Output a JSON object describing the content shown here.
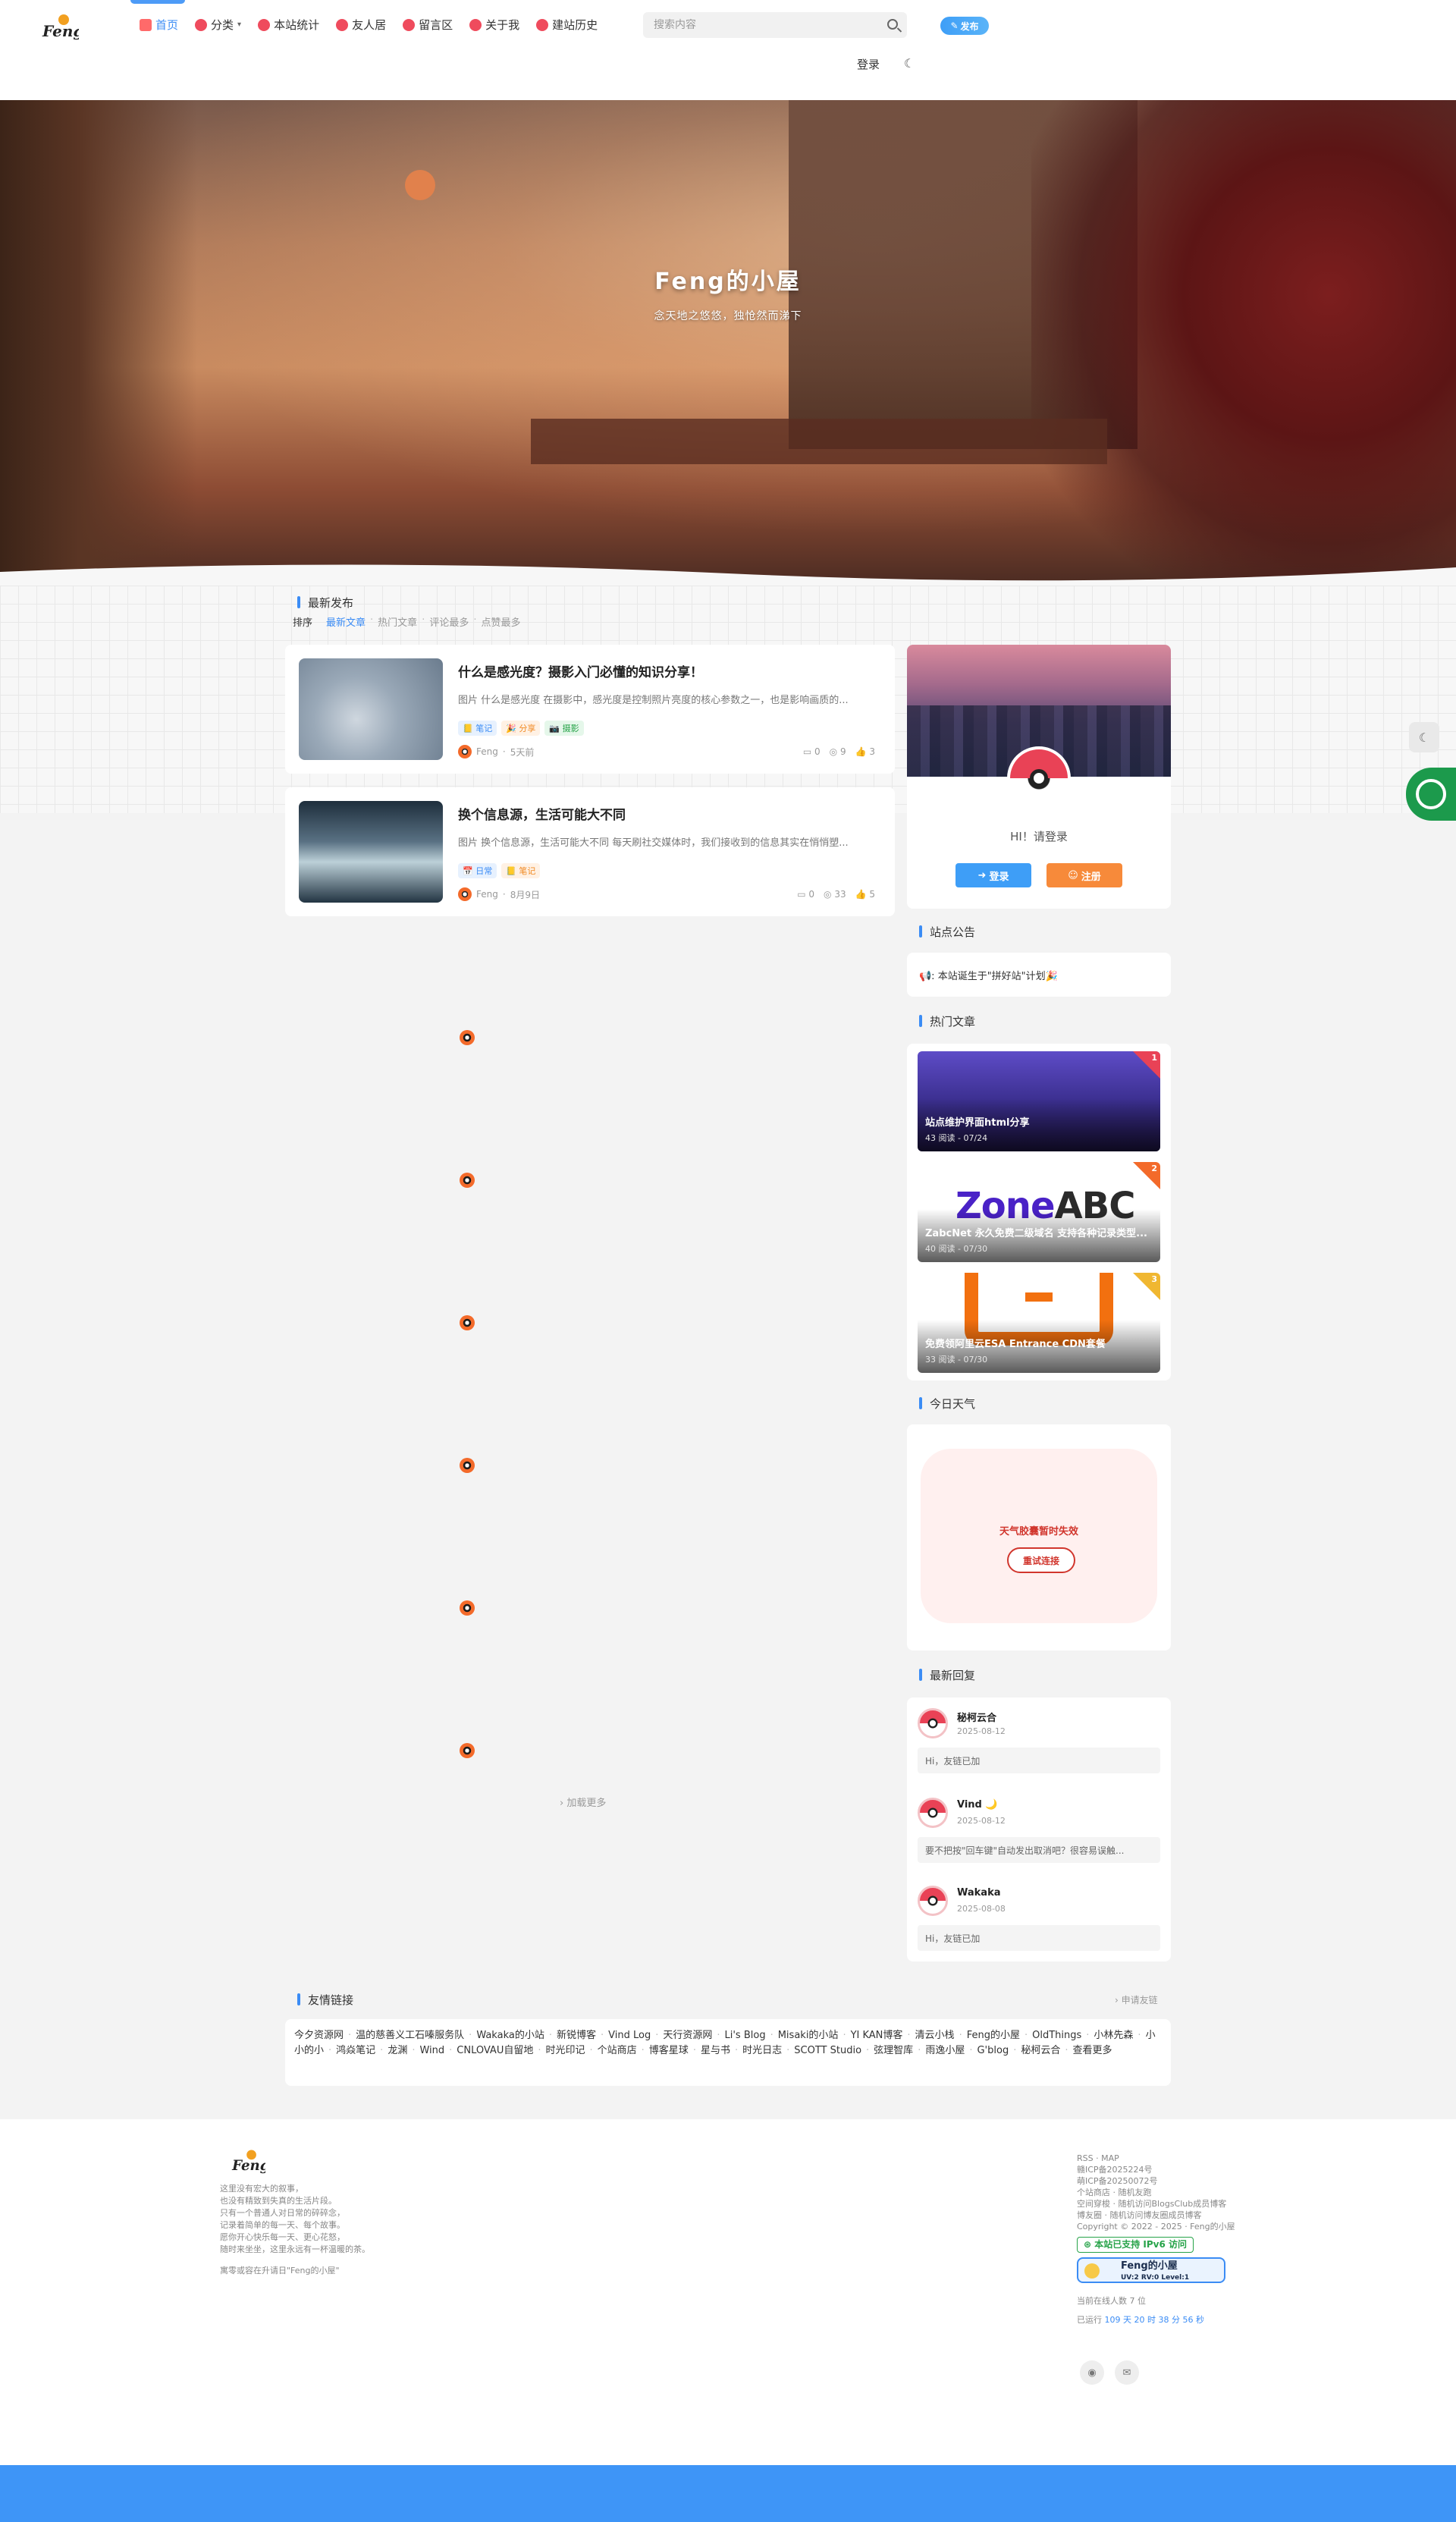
{
  "header": {
    "logo_text": "Feng",
    "nav": [
      {
        "label": "首页",
        "icon": "home-icon",
        "active": true
      },
      {
        "label": "分类",
        "icon": "category-icon",
        "dropdown": true
      },
      {
        "label": "本站统计",
        "icon": "stats-icon"
      },
      {
        "label": "友人居",
        "icon": "friends-icon"
      },
      {
        "label": "留言区",
        "icon": "message-icon"
      },
      {
        "label": "关于我",
        "icon": "star-icon"
      },
      {
        "label": "建站历史",
        "icon": "history-icon"
      }
    ],
    "search_placeholder": "搜索内容",
    "publish_label": "发布",
    "login_label": "登录"
  },
  "hero": {
    "title": "Feng的小屋",
    "subtitle": "念天地之悠悠，独怆然而涕下"
  },
  "main": {
    "section_title": "最新发布",
    "sort_label": "排序",
    "sort_options": [
      "最新文章",
      "热门文章",
      "评论最多",
      "点赞最多"
    ],
    "posts": [
      {
        "title": "什么是感光度？摄影入门必懂的知识分享！",
        "excerpt": "图片 什么是感光度 在摄影中，感光度是控制照片亮度的核心参数之一，也是影响画质的...",
        "tags": [
          {
            "label": "📒 笔记",
            "color": "blue"
          },
          {
            "label": "🎉 分享",
            "color": "orange"
          },
          {
            "label": "📷 摄影",
            "color": "green"
          }
        ],
        "author": "Feng",
        "time": "5天前",
        "comments": "0",
        "views": "9",
        "likes": "3"
      },
      {
        "title": "换个信息源，生活可能大不同",
        "excerpt": "图片 换个信息源，生活可能大不同 每天刷社交媒体时，我们接收到的信息其实在悄悄塑...",
        "tags": [
          {
            "label": "📅 日常",
            "color": "blue"
          },
          {
            "label": "📒 笔记",
            "color": "orange"
          }
        ],
        "author": "Feng",
        "time": "8月9日",
        "comments": "0",
        "views": "33",
        "likes": "5"
      }
    ],
    "load_more": "加载更多"
  },
  "sidebar": {
    "user": {
      "greeting": "HI！请登录",
      "login_label": "登录",
      "register_label": "注册"
    },
    "notice": {
      "title": "站点公告",
      "text": "📢: 本站诞生于\"拼好站\"计划🎉"
    },
    "hot": {
      "title": "热门文章",
      "items": [
        {
          "title": "站点维护界面html分享",
          "meta": "43 阅读 - 07/24",
          "rank": "1"
        },
        {
          "title": "ZabcNet 永久免费二级域名 支持各种记录类型...",
          "meta": "40 阅读 - 07/30",
          "rank": "2"
        },
        {
          "title": "免费领阿里云ESA Entrance CDN套餐",
          "meta": "33 阅读 - 07/30",
          "rank": "3"
        }
      ]
    },
    "weather": {
      "title": "今日天气",
      "error": "天气胶囊暂时失效",
      "retry": "重试连接"
    },
    "replies": {
      "title": "最新回复",
      "items": [
        {
          "name": "秘柯云合",
          "date": "2025-08-12",
          "text": "Hi，友链已加"
        },
        {
          "name": "Vind 🌙",
          "date": "2025-08-12",
          "text": "要不把按\"回车键\"自动发出取消吧？很容易误触..."
        },
        {
          "name": "Wakaka",
          "date": "2025-08-08",
          "text": "Hi，友链已加"
        }
      ]
    }
  },
  "links": {
    "title": "友情链接",
    "apply": "申请友链",
    "items": [
      "今夕资源网",
      "温的慈善义工石嗪服务队",
      "Wakaka的小站",
      "新锐博客",
      "Vind Log",
      "天行资源网",
      "Li's Blog",
      "Misaki的小站",
      "YI KAN博客",
      "清云小栈",
      "Feng的小屋",
      "OldThings",
      "小林先森",
      "小小的小",
      "鸿焱笔记",
      "龙渊",
      "Wind",
      "CNLOVAU自留地",
      "时光印记",
      "个站商店",
      "博客星球",
      "星与书",
      "时光日志",
      "SCOTT Studio",
      "弦理智库",
      "雨逸小屋",
      "G'blog",
      "秘柯云合",
      "查看更多"
    ]
  },
  "footer": {
    "about_lines": [
      "这里没有宏大的叙事，",
      "也没有精致到失真的生活片段。",
      "只有一个普通人对日常的碎碎念，",
      "记录着简单的每一天、每个故事。",
      "愿你开心快乐每一天、更心花怒，",
      "随时来坐坐，这里永远有一杯温暖的茶。"
    ],
    "quote": "寓零或容在升请日\"Feng的小屋\"",
    "right_lines": [
      "RSS · MAP",
      "赣ICP备2025224号",
      "萌ICP备20250072号",
      "个站商店 · 随机友跑",
      "空间穿梭 · 随机访问BlogsClub成员博客",
      "博友圈 · 随机访问博友圈成员博客",
      "Copyright © 2022 - 2025 · Feng的小屋"
    ],
    "ipv6": "本站已支持 IPv6 访问",
    "badge_name": "Feng的小屋",
    "badge_level": "UV:2 RV:0 Level:1",
    "online": "当前在线人数 7 位",
    "uptime_prefix": "已运行",
    "uptime_value": "109 天 20 时 38 分 56 秒"
  }
}
